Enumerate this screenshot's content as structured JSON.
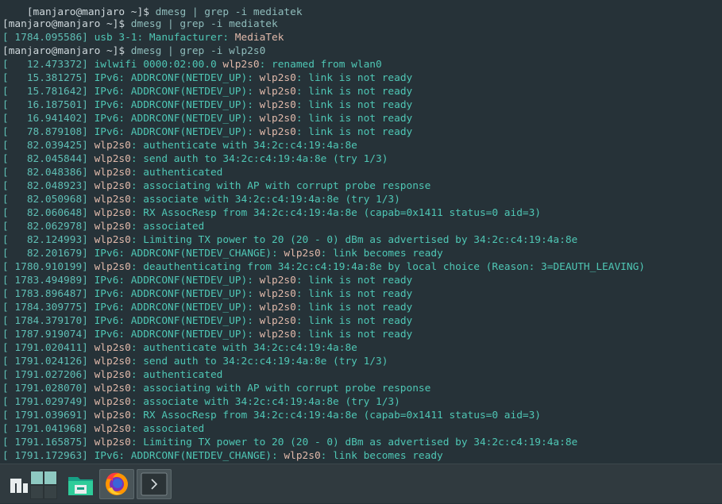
{
  "colors": {
    "background": "#263238",
    "default": "#cfd8dc",
    "prompt": "#cfd8dc",
    "cmd": "#8fbcbb",
    "ts": "#5fbfb5",
    "text": "#4fc7b5",
    "dev": "#e0b9aa",
    "vendor": "#e0b9aa",
    "cursor": "#1abc9c",
    "taskbar": "#303a3f"
  },
  "terminal": {
    "prompt": "[manjaro@manjaro ~]$ ",
    "lines": [
      [
        [
          "prompt",
          "[manjaro@manjaro ~]$ "
        ],
        [
          "cmd",
          "dmesg | grep -i mediatek"
        ]
      ],
      [
        [
          "ts",
          "[ 1784.095586] "
        ],
        [
          "text",
          "usb 3-1: Manufacturer: "
        ],
        [
          "vendor",
          "MediaTek"
        ]
      ],
      [
        [
          "prompt",
          "[manjaro@manjaro ~]$ "
        ],
        [
          "cmd",
          "dmesg | grep -i wlp2s0"
        ]
      ],
      [
        [
          "ts",
          "[   12.473372] "
        ],
        [
          "text",
          "iwlwifi 0000:02:00.0 "
        ],
        [
          "dev",
          "wlp2s0"
        ],
        [
          "text",
          ": renamed from wlan0"
        ]
      ],
      [
        [
          "ts",
          "[   15.381275] "
        ],
        [
          "text",
          "IPv6: ADDRCONF(NETDEV_UP): "
        ],
        [
          "dev",
          "wlp2s0"
        ],
        [
          "text",
          ": link is not ready"
        ]
      ],
      [
        [
          "ts",
          "[   15.781642] "
        ],
        [
          "text",
          "IPv6: ADDRCONF(NETDEV_UP): "
        ],
        [
          "dev",
          "wlp2s0"
        ],
        [
          "text",
          ": link is not ready"
        ]
      ],
      [
        [
          "ts",
          "[   16.187501] "
        ],
        [
          "text",
          "IPv6: ADDRCONF(NETDEV_UP): "
        ],
        [
          "dev",
          "wlp2s0"
        ],
        [
          "text",
          ": link is not ready"
        ]
      ],
      [
        [
          "ts",
          "[   16.941402] "
        ],
        [
          "text",
          "IPv6: ADDRCONF(NETDEV_UP): "
        ],
        [
          "dev",
          "wlp2s0"
        ],
        [
          "text",
          ": link is not ready"
        ]
      ],
      [
        [
          "ts",
          "[   78.879108] "
        ],
        [
          "text",
          "IPv6: ADDRCONF(NETDEV_UP): "
        ],
        [
          "dev",
          "wlp2s0"
        ],
        [
          "text",
          ": link is not ready"
        ]
      ],
      [
        [
          "ts",
          "[   82.039425] "
        ],
        [
          "dev",
          "wlp2s0"
        ],
        [
          "text",
          ": authenticate with 34:2c:c4:19:4a:8e"
        ]
      ],
      [
        [
          "ts",
          "[   82.045844] "
        ],
        [
          "dev",
          "wlp2s0"
        ],
        [
          "text",
          ": send auth to 34:2c:c4:19:4a:8e (try 1/3)"
        ]
      ],
      [
        [
          "ts",
          "[   82.048386] "
        ],
        [
          "dev",
          "wlp2s0"
        ],
        [
          "text",
          ": authenticated"
        ]
      ],
      [
        [
          "ts",
          "[   82.048923] "
        ],
        [
          "dev",
          "wlp2s0"
        ],
        [
          "text",
          ": associating with AP with corrupt probe response"
        ]
      ],
      [
        [
          "ts",
          "[   82.050968] "
        ],
        [
          "dev",
          "wlp2s0"
        ],
        [
          "text",
          ": associate with 34:2c:c4:19:4a:8e (try 1/3)"
        ]
      ],
      [
        [
          "ts",
          "[   82.060648] "
        ],
        [
          "dev",
          "wlp2s0"
        ],
        [
          "text",
          ": RX AssocResp from 34:2c:c4:19:4a:8e (capab=0x1411 status=0 aid=3)"
        ]
      ],
      [
        [
          "ts",
          "[   82.062978] "
        ],
        [
          "dev",
          "wlp2s0"
        ],
        [
          "text",
          ": associated"
        ]
      ],
      [
        [
          "ts",
          "[   82.124993] "
        ],
        [
          "dev",
          "wlp2s0"
        ],
        [
          "text",
          ": Limiting TX power to 20 (20 - 0) dBm as advertised by 34:2c:c4:19:4a:8e"
        ]
      ],
      [
        [
          "ts",
          "[   82.201679] "
        ],
        [
          "text",
          "IPv6: ADDRCONF(NETDEV_CHANGE): "
        ],
        [
          "dev",
          "wlp2s0"
        ],
        [
          "text",
          ": link becomes ready"
        ]
      ],
      [
        [
          "ts",
          "[ 1780.910199] "
        ],
        [
          "dev",
          "wlp2s0"
        ],
        [
          "text",
          ": deauthenticating from 34:2c:c4:19:4a:8e by local choice (Reason: 3=DEAUTH_LEAVING)"
        ]
      ],
      [
        [
          "ts",
          "[ 1783.494989] "
        ],
        [
          "text",
          "IPv6: ADDRCONF(NETDEV_UP): "
        ],
        [
          "dev",
          "wlp2s0"
        ],
        [
          "text",
          ": link is not ready"
        ]
      ],
      [
        [
          "ts",
          "[ 1783.896487] "
        ],
        [
          "text",
          "IPv6: ADDRCONF(NETDEV_UP): "
        ],
        [
          "dev",
          "wlp2s0"
        ],
        [
          "text",
          ": link is not ready"
        ]
      ],
      [
        [
          "ts",
          "[ 1784.309775] "
        ],
        [
          "text",
          "IPv6: ADDRCONF(NETDEV_UP): "
        ],
        [
          "dev",
          "wlp2s0"
        ],
        [
          "text",
          ": link is not ready"
        ]
      ],
      [
        [
          "ts",
          "[ 1784.379170] "
        ],
        [
          "text",
          "IPv6: ADDRCONF(NETDEV_UP): "
        ],
        [
          "dev",
          "wlp2s0"
        ],
        [
          "text",
          ": link is not ready"
        ]
      ],
      [
        [
          "ts",
          "[ 1787.919074] "
        ],
        [
          "text",
          "IPv6: ADDRCONF(NETDEV_UP): "
        ],
        [
          "dev",
          "wlp2s0"
        ],
        [
          "text",
          ": link is not ready"
        ]
      ],
      [
        [
          "ts",
          "[ 1791.020411] "
        ],
        [
          "dev",
          "wlp2s0"
        ],
        [
          "text",
          ": authenticate with 34:2c:c4:19:4a:8e"
        ]
      ],
      [
        [
          "ts",
          "[ 1791.024126] "
        ],
        [
          "dev",
          "wlp2s0"
        ],
        [
          "text",
          ": send auth to 34:2c:c4:19:4a:8e (try 1/3)"
        ]
      ],
      [
        [
          "ts",
          "[ 1791.027206] "
        ],
        [
          "dev",
          "wlp2s0"
        ],
        [
          "text",
          ": authenticated"
        ]
      ],
      [
        [
          "ts",
          "[ 1791.028070] "
        ],
        [
          "dev",
          "wlp2s0"
        ],
        [
          "text",
          ": associating with AP with corrupt probe response"
        ]
      ],
      [
        [
          "ts",
          "[ 1791.029749] "
        ],
        [
          "dev",
          "wlp2s0"
        ],
        [
          "text",
          ": associate with 34:2c:c4:19:4a:8e (try 1/3)"
        ]
      ],
      [
        [
          "ts",
          "[ 1791.039691] "
        ],
        [
          "dev",
          "wlp2s0"
        ],
        [
          "text",
          ": RX AssocResp from 34:2c:c4:19:4a:8e (capab=0x1411 status=0 aid=3)"
        ]
      ],
      [
        [
          "ts",
          "[ 1791.041968] "
        ],
        [
          "dev",
          "wlp2s0"
        ],
        [
          "text",
          ": associated"
        ]
      ],
      [
        [
          "ts",
          "[ 1791.165875] "
        ],
        [
          "dev",
          "wlp2s0"
        ],
        [
          "text",
          ": Limiting TX power to 20 (20 - 0) dBm as advertised by 34:2c:c4:19:4a:8e"
        ]
      ],
      [
        [
          "ts",
          "[ 1791.172963] "
        ],
        [
          "text",
          "IPv6: ADDRCONF(NETDEV_CHANGE): "
        ],
        [
          "dev",
          "wlp2s0"
        ],
        [
          "text",
          ": link becomes ready"
        ]
      ]
    ]
  },
  "taskbar": {
    "items": [
      {
        "name": "manjaro-menu-icon"
      },
      {
        "name": "workspace-switcher-icon"
      },
      {
        "name": "file-manager-icon"
      },
      {
        "name": "firefox-icon"
      },
      {
        "name": "terminal-icon"
      }
    ]
  }
}
